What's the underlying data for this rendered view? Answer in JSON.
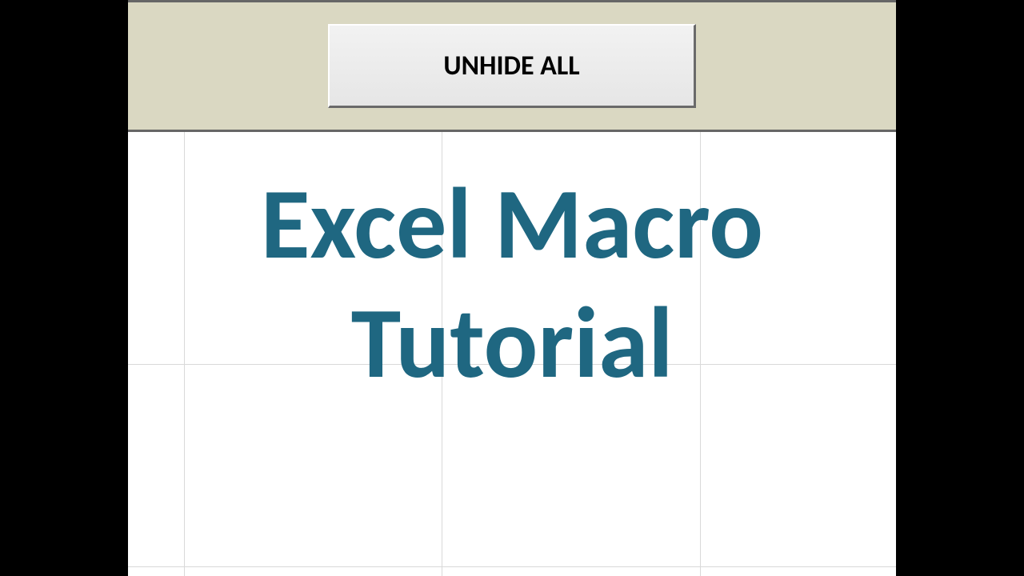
{
  "macro_button": {
    "label": "UNHIDE ALL"
  },
  "title": {
    "line1": "Excel Macro",
    "line2": "Tutorial"
  },
  "colors": {
    "header_bg": "#dad8c2",
    "title_text": "#1f6781",
    "gridline": "#d9d9d9"
  }
}
